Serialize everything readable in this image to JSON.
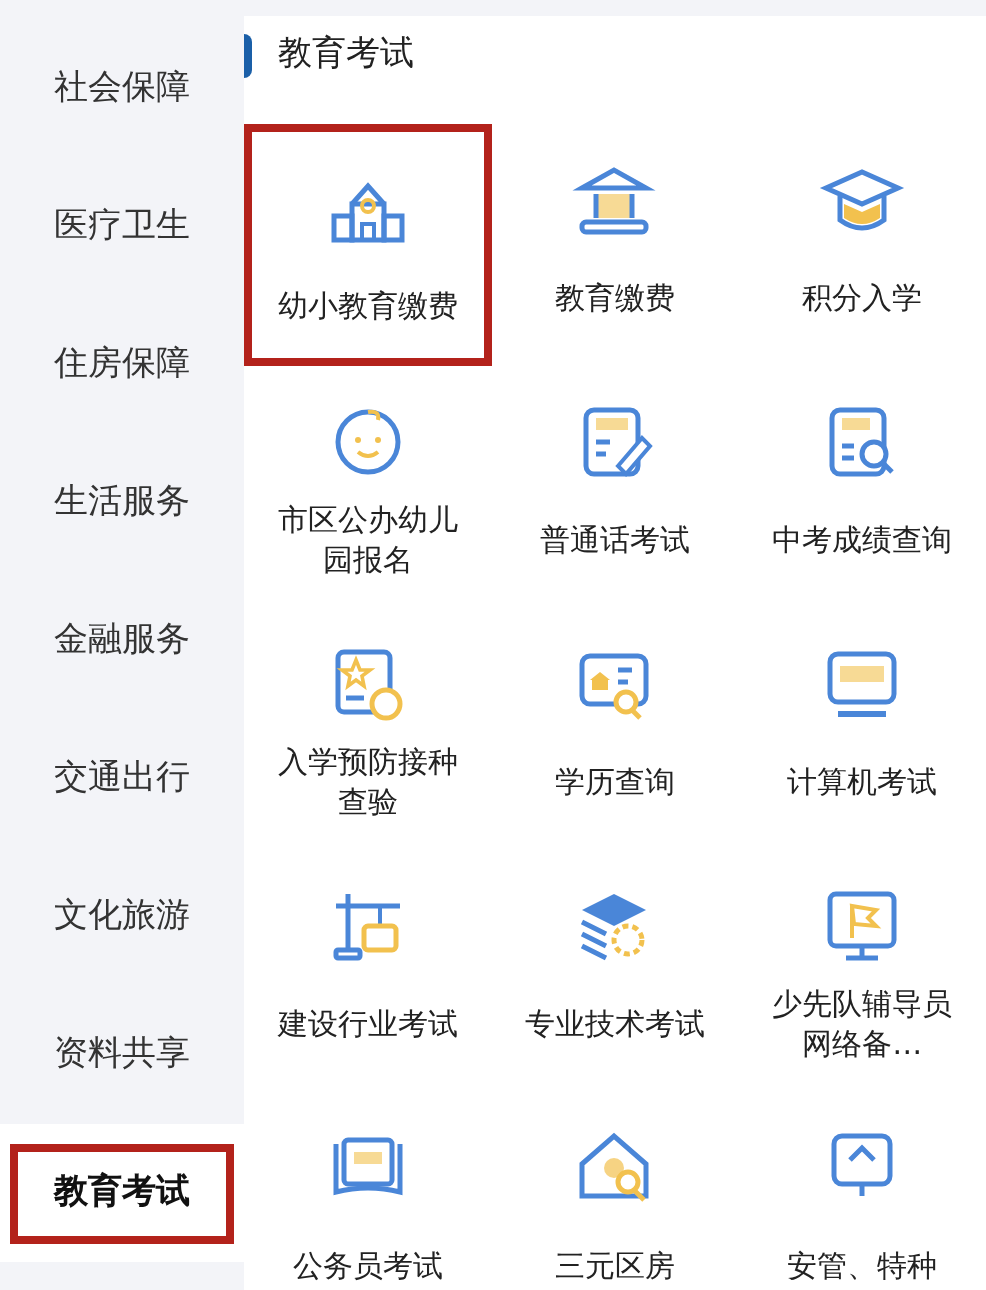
{
  "sidebar": {
    "items": [
      {
        "label": "社会保障",
        "selected": false,
        "highlighted": false
      },
      {
        "label": "医疗卫生",
        "selected": false,
        "highlighted": false
      },
      {
        "label": "住房保障",
        "selected": false,
        "highlighted": false
      },
      {
        "label": "生活服务",
        "selected": false,
        "highlighted": false
      },
      {
        "label": "金融服务",
        "selected": false,
        "highlighted": false
      },
      {
        "label": "交通出行",
        "selected": false,
        "highlighted": false
      },
      {
        "label": "文化旅游",
        "selected": false,
        "highlighted": false
      },
      {
        "label": "资料共享",
        "selected": false,
        "highlighted": false
      },
      {
        "label": "教育考试",
        "selected": true,
        "highlighted": true
      }
    ]
  },
  "section": {
    "title": "教育考试",
    "services": [
      {
        "label": "幼小教育缴费",
        "highlighted": true
      },
      {
        "label": "教育缴费",
        "highlighted": false
      },
      {
        "label": "积分入学",
        "highlighted": false
      },
      {
        "label": "市区公办幼儿园报名",
        "highlighted": false
      },
      {
        "label": "普通话考试",
        "highlighted": false
      },
      {
        "label": "中考成绩查询",
        "highlighted": false
      },
      {
        "label": "入学预防接种查验",
        "highlighted": false
      },
      {
        "label": "学历查询",
        "highlighted": false
      },
      {
        "label": "计算机考试",
        "highlighted": false
      },
      {
        "label": "建设行业考试",
        "highlighted": false
      },
      {
        "label": "专业技术考试",
        "highlighted": false
      },
      {
        "label": "少先队辅导员网络备…",
        "highlighted": false
      },
      {
        "label": "公务员考试",
        "highlighted": false
      },
      {
        "label": "三元区房",
        "highlighted": false
      },
      {
        "label": "安管、特种",
        "highlighted": false
      }
    ]
  }
}
